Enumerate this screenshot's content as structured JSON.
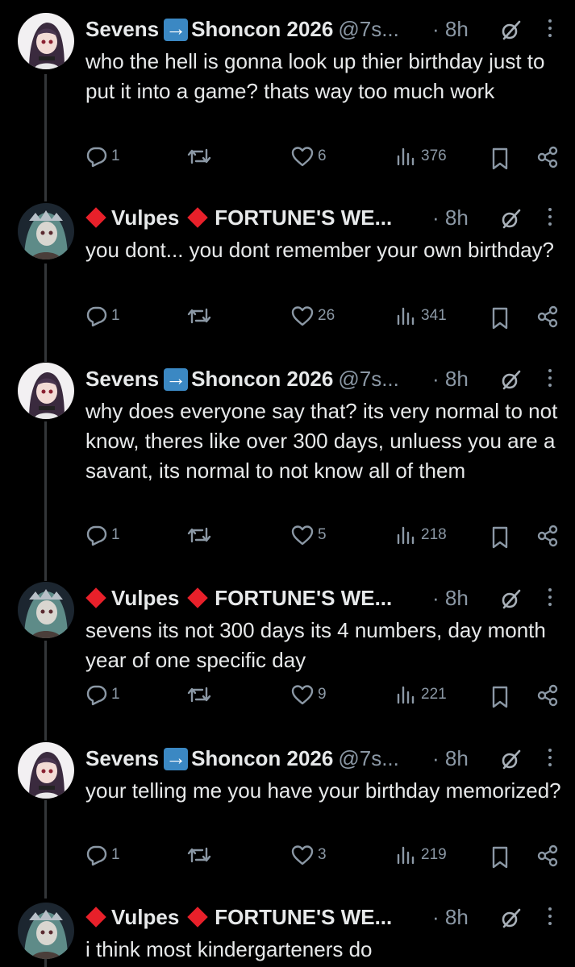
{
  "tweets": [
    {
      "author": "sevens",
      "name_pre": "Sevens",
      "name_post": "Shoncon 2026",
      "handle": "@7s...",
      "time": "· 8h",
      "text": "who the hell is gonna look up thier birthday just to put it into a game? thats way too much work",
      "replies": "1",
      "likes": "6",
      "views": "376"
    },
    {
      "author": "vulpes",
      "name_pre": "Vulpes",
      "name_post": "FORTUNE'S WE...",
      "handle": "",
      "time": "· 8h",
      "text": "you dont... you dont remember your own birthday?",
      "replies": "1",
      "likes": "26",
      "views": "341"
    },
    {
      "author": "sevens",
      "name_pre": "Sevens",
      "name_post": "Shoncon 2026",
      "handle": "@7s...",
      "time": "· 8h",
      "text": "why does everyone say that? its very normal to not know, theres like over 300 days, unluess you are a savant, its normal to not know all of them",
      "replies": "1",
      "likes": "5",
      "views": "218"
    },
    {
      "author": "vulpes",
      "name_pre": "Vulpes",
      "name_post": "FORTUNE'S WE...",
      "handle": "",
      "time": "· 8h",
      "text": "sevens its not 300 days its 4 numbers, day month year of one specific day",
      "replies": "1",
      "likes": "9",
      "views": "221"
    },
    {
      "author": "sevens",
      "name_pre": "Sevens",
      "name_post": "Shoncon 2026",
      "handle": "@7s...",
      "time": "· 8h",
      "text": "your telling me you have your birthday memorized?",
      "replies": "1",
      "likes": "3",
      "views": "219"
    },
    {
      "author": "vulpes",
      "name_pre": "Vulpes",
      "name_post": "FORTUNE'S WE...",
      "handle": "",
      "time": "· 8h",
      "text": "i think most kindergarteners do",
      "replies": "",
      "likes": "",
      "views": ""
    }
  ],
  "icons": {
    "reply": "reply-icon",
    "retweet": "retweet-icon",
    "like": "heart-icon",
    "views": "views-icon",
    "bookmark": "bookmark-icon",
    "share": "share-icon",
    "grok": "grok-icon",
    "more": "more-icon"
  },
  "colors": {
    "background": "#000000",
    "text": "#e7e9ea",
    "muted": "#8b98a5",
    "arrow_badge": "#3b88c3",
    "diamond": "#e8202a"
  }
}
